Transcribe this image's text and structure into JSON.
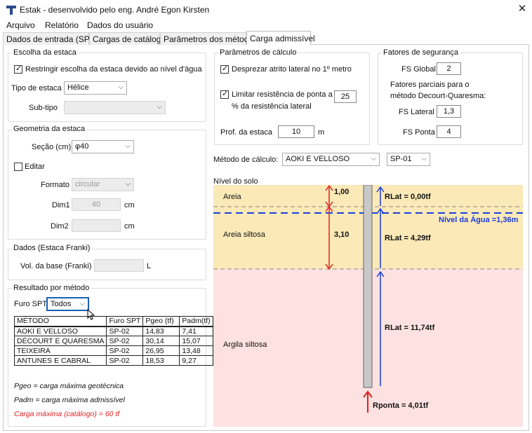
{
  "window": {
    "title": "Estak - desenvolvido pelo eng. André Egon Kirsten",
    "close_glyph": "✕"
  },
  "menu": [
    "Arquivo",
    "Relatório",
    "Dados do usuário"
  ],
  "tabs": [
    "Dados de entrada (SPT)",
    "Cargas de catálogo",
    "Parâmetros dos métodos",
    "Carga admissível"
  ],
  "escolha": {
    "title": "Escolha da estaca",
    "restringir_label": "Restringir escolha da estaca devido ao nível d'água",
    "restringir_checked": true,
    "tipo_label": "Tipo de estaca",
    "tipo_value": "Hélice",
    "subtipo_label": "Sub-tipo",
    "subtipo_value": ""
  },
  "geometria": {
    "title": "Geometria da estaca",
    "secao_label": "Seção (cm)",
    "secao_value": "φ40",
    "editar_label": "Editar",
    "editar_checked": false,
    "formato_label": "Formato",
    "formato_value": "circular",
    "dim1_label": "Dim1",
    "dim1_value": "40",
    "dim1_unit": "cm",
    "dim2_label": "Dim2",
    "dim2_value": "",
    "dim2_unit": "cm"
  },
  "franki": {
    "title": "Dados (Estaca Franki)",
    "vol_label": "Vol. da base (Franki)",
    "vol_value": "",
    "vol_unit": "L"
  },
  "resultado": {
    "title": "Resultado por método",
    "furo_label": "Furo SPT",
    "furo_value": "Todos",
    "headers": [
      "MÉTODO",
      "Furo SPT",
      "Pgeo (tf)",
      "Padm(tf)"
    ],
    "rows": [
      [
        "AOKI E VELLOSO",
        "SP-02",
        "14,83",
        "7,41"
      ],
      [
        "DÉCOURT E QUARESMA",
        "SP-02",
        "30,14",
        "15,07"
      ],
      [
        "TEIXEIRA",
        "SP-02",
        "26,95",
        "13,48"
      ],
      [
        "ANTUNES E CABRAL",
        "SP-02",
        "18,53",
        "9,27"
      ]
    ],
    "note1": "Pgeo = carga máxima geotécnica",
    "note2": "Padm = carga máxima admissível",
    "note3": "Carga máxima (catálogo) = 60 tf"
  },
  "calculo": {
    "title": "Parâmetros de cálculo",
    "desprezar_label": "Desprezar atrito lateral no 1º metro",
    "desprezar_checked": true,
    "limitar_label_1": "Limitar resistência de ponta a",
    "limitar_label_2": "% da resistência lateral",
    "limitar_checked": true,
    "limitar_value": "25",
    "prof_label": "Prof. da estaca",
    "prof_value": "10",
    "prof_unit": "m"
  },
  "fatores": {
    "title": "Fatores de segurança",
    "fs_global_label": "FS Global",
    "fs_global_value": "2",
    "parciais_1": "Fatores parciais para o",
    "parciais_2": "método Decourt-Quaresma:",
    "fs_lateral_label": "FS Lateral",
    "fs_lateral_value": "1,3",
    "fs_ponta_label": "FS Ponta",
    "fs_ponta_value": "4"
  },
  "metodo": {
    "label": "Método de cálculo:",
    "value": "AOKI E VELLOSO",
    "furo_value": "SP-01"
  },
  "profile": {
    "nivel_solo": "Nível do solo",
    "layers": [
      {
        "name": "Areia",
        "thickness": "1,00",
        "rlat": "RLat = 0,00tf",
        "color": "#fbe9b7"
      },
      {
        "name": "Areia siltosa",
        "thickness": "3,10",
        "rlat": "RLat = 4,29tf",
        "color": "#fbe9b7"
      },
      {
        "name": "Argila siltosa",
        "thickness": "",
        "rlat": "RLat = 11,74tf",
        "color": "#fde2e1"
      }
    ],
    "nivel_agua": "Nível da Água =1,36m",
    "rponta": "Rponta = 4,01tf",
    "colors": {
      "arrow_red": "#e02020",
      "arrow_blue": "#1a3de0",
      "pile": "#c8c8c8"
    }
  }
}
